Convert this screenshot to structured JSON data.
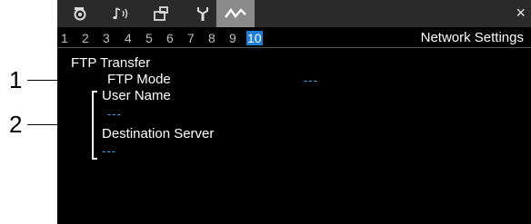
{
  "callouts": [
    "1",
    "2"
  ],
  "icon_tabs": [
    {
      "icon": "camera-icon"
    },
    {
      "icon": "audio-icon"
    },
    {
      "icon": "recording-setup-icon"
    },
    {
      "icon": "wrench-icon"
    },
    {
      "icon": "network-icon",
      "active": true
    }
  ],
  "close_label": "×",
  "pages": [
    "1",
    "2",
    "3",
    "4",
    "5",
    "6",
    "7",
    "8",
    "9",
    "10"
  ],
  "active_page": "10",
  "page_title": "Network Settings",
  "section_title": "FTP Transfer",
  "ftp_mode": {
    "label": "FTP Mode",
    "value": "---"
  },
  "user_name": {
    "label": "User Name",
    "value": "---"
  },
  "destination_server": {
    "label": "Destination Server",
    "value": "---"
  },
  "colors": {
    "screen_bg": "#000000",
    "tab_bar_bg": "#2b2b2b",
    "active_tab_bg": "#8a8a8a",
    "active_page_bg": "#1d7fd6",
    "value_blue": "#39a9f0"
  }
}
